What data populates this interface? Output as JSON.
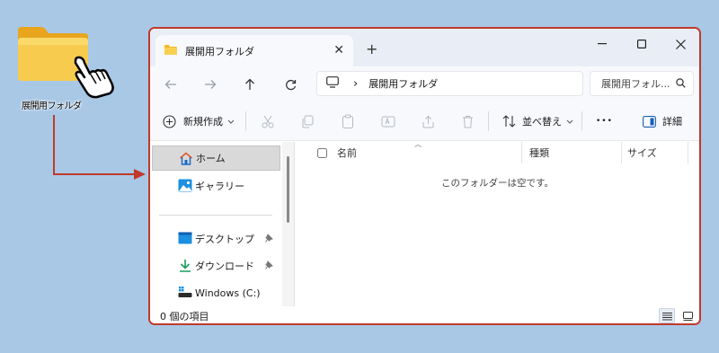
{
  "desktop": {
    "folder_label": "展開用フォルダ"
  },
  "window": {
    "tab_title": "展開用フォルダ",
    "tab_close": "✕",
    "tab_new": "+",
    "address_path": "展開用フォルダ",
    "address_chevron": "›",
    "search_placeholder": "展開用フォル..."
  },
  "toolbar": {
    "new_label": "新規作成",
    "sort_label": "並べ替え",
    "more_label": "•••",
    "details_label": "詳細"
  },
  "sidebar": {
    "items": [
      {
        "label": "ホーム"
      },
      {
        "label": "ギャラリー"
      },
      {
        "label": "デスクトップ"
      },
      {
        "label": "ダウンロード"
      },
      {
        "label": "Windows (C:)"
      }
    ]
  },
  "file_list": {
    "columns": [
      "名前",
      "種類",
      "サイズ"
    ],
    "empty_message": "このフォルダーは空です。"
  },
  "status": {
    "item_count": "0 個の項目"
  },
  "colors": {
    "accent": "#c0392b",
    "folder": "#f5c342",
    "window_chrome": "#e9eef6"
  }
}
